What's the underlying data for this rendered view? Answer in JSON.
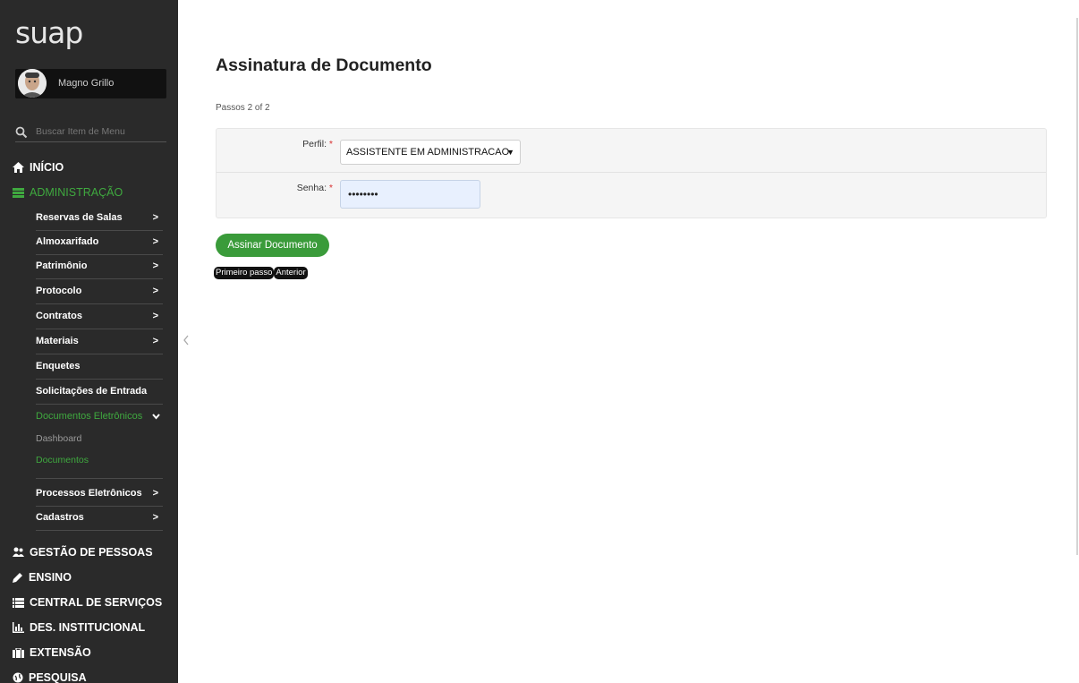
{
  "app": {
    "logo": "suap"
  },
  "user": {
    "name": "Magno Grillo"
  },
  "search": {
    "placeholder": "Buscar Item de Menu"
  },
  "sidebar": {
    "top": [
      {
        "label": "INÍCIO",
        "icon": "home-icon"
      },
      {
        "label": "ADMINISTRAÇÃO",
        "icon": "list-icon",
        "active": true
      }
    ],
    "admin_items": [
      {
        "label": "Reservas de Salas",
        "chevron": ">"
      },
      {
        "label": "Almoxarifado",
        "chevron": ">"
      },
      {
        "label": "Patrimônio",
        "chevron": ">"
      },
      {
        "label": "Protocolo",
        "chevron": ">"
      },
      {
        "label": "Contratos",
        "chevron": ">"
      },
      {
        "label": "Materiais",
        "chevron": ">"
      },
      {
        "label": "Enquetes"
      },
      {
        "label": "Solicitações de Entrada"
      },
      {
        "label": "Documentos Eletrônicos",
        "expanded": true
      },
      {
        "label": "Processos Eletrônicos",
        "chevron": ">"
      },
      {
        "label": "Cadastros",
        "chevron": ">"
      }
    ],
    "doc_sub": [
      {
        "label": "Dashboard"
      },
      {
        "label": "Documentos",
        "active": true
      }
    ],
    "sections": [
      {
        "label": "GESTÃO DE PESSOAS",
        "icon": "users-icon"
      },
      {
        "label": "ENSINO",
        "icon": "pencil-icon"
      },
      {
        "label": "CENTRAL DE SERVIÇOS",
        "icon": "list-icon"
      },
      {
        "label": "DES. INSTITUCIONAL",
        "icon": "bar-chart-icon"
      },
      {
        "label": "EXTENSÃO",
        "icon": "briefcase-icon"
      },
      {
        "label": "PESQUISA",
        "icon": "globe-icon"
      }
    ]
  },
  "main": {
    "title": "Assinatura de Documento",
    "steps": "Passos 2 of 2",
    "form": {
      "perfil_label": "Perfil:",
      "perfil_value": "ASSISTENTE EM ADMINISTRACAO",
      "senha_label": "Senha:",
      "senha_value": "••••••••",
      "required_mark": "*"
    },
    "submit_label": "Assinar Documento",
    "first_step_label": "Primeiro passo",
    "previous_label": "Anterior"
  },
  "colors": {
    "sidebar_bg": "#2a2a2a",
    "accent_green": "#3fa93f",
    "button_green": "#3a9b3a"
  }
}
